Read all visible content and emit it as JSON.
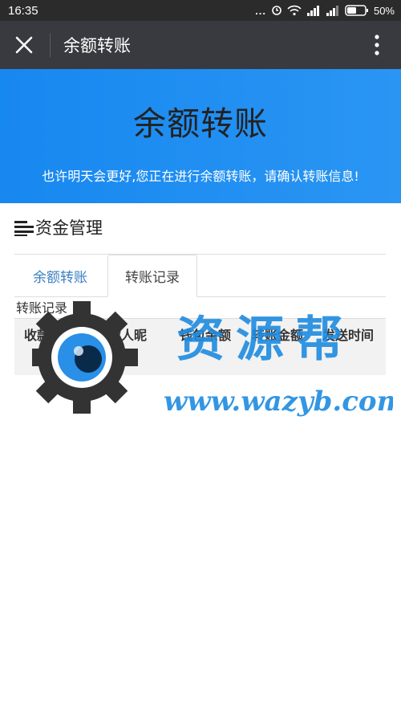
{
  "status": {
    "time": "16:35",
    "dots": "...",
    "battery": "50%"
  },
  "navbar": {
    "title": "余额转账",
    "close_icon": "close-icon",
    "more_icon": "more-vertical-icon"
  },
  "banner": {
    "title": "余额转账",
    "subtitle": "也许明天会更好,您正在进行余额转账，请确认转账信息!"
  },
  "section": {
    "heading": "资金管理",
    "icon": "menu-lines-icon"
  },
  "tabs": [
    {
      "label": "余额转账",
      "active": false
    },
    {
      "label": "转账记录",
      "active": true
    }
  ],
  "records": {
    "label": "转账记录",
    "columns": [
      "收款人ID",
      "收款人昵",
      "钱包余额",
      "转账金额",
      "发送时间"
    ],
    "rows": []
  },
  "watermark": {
    "name": "资源帮",
    "url": "www.wazyb.com",
    "color": "#1e8be0",
    "gear_color": "#333333"
  }
}
